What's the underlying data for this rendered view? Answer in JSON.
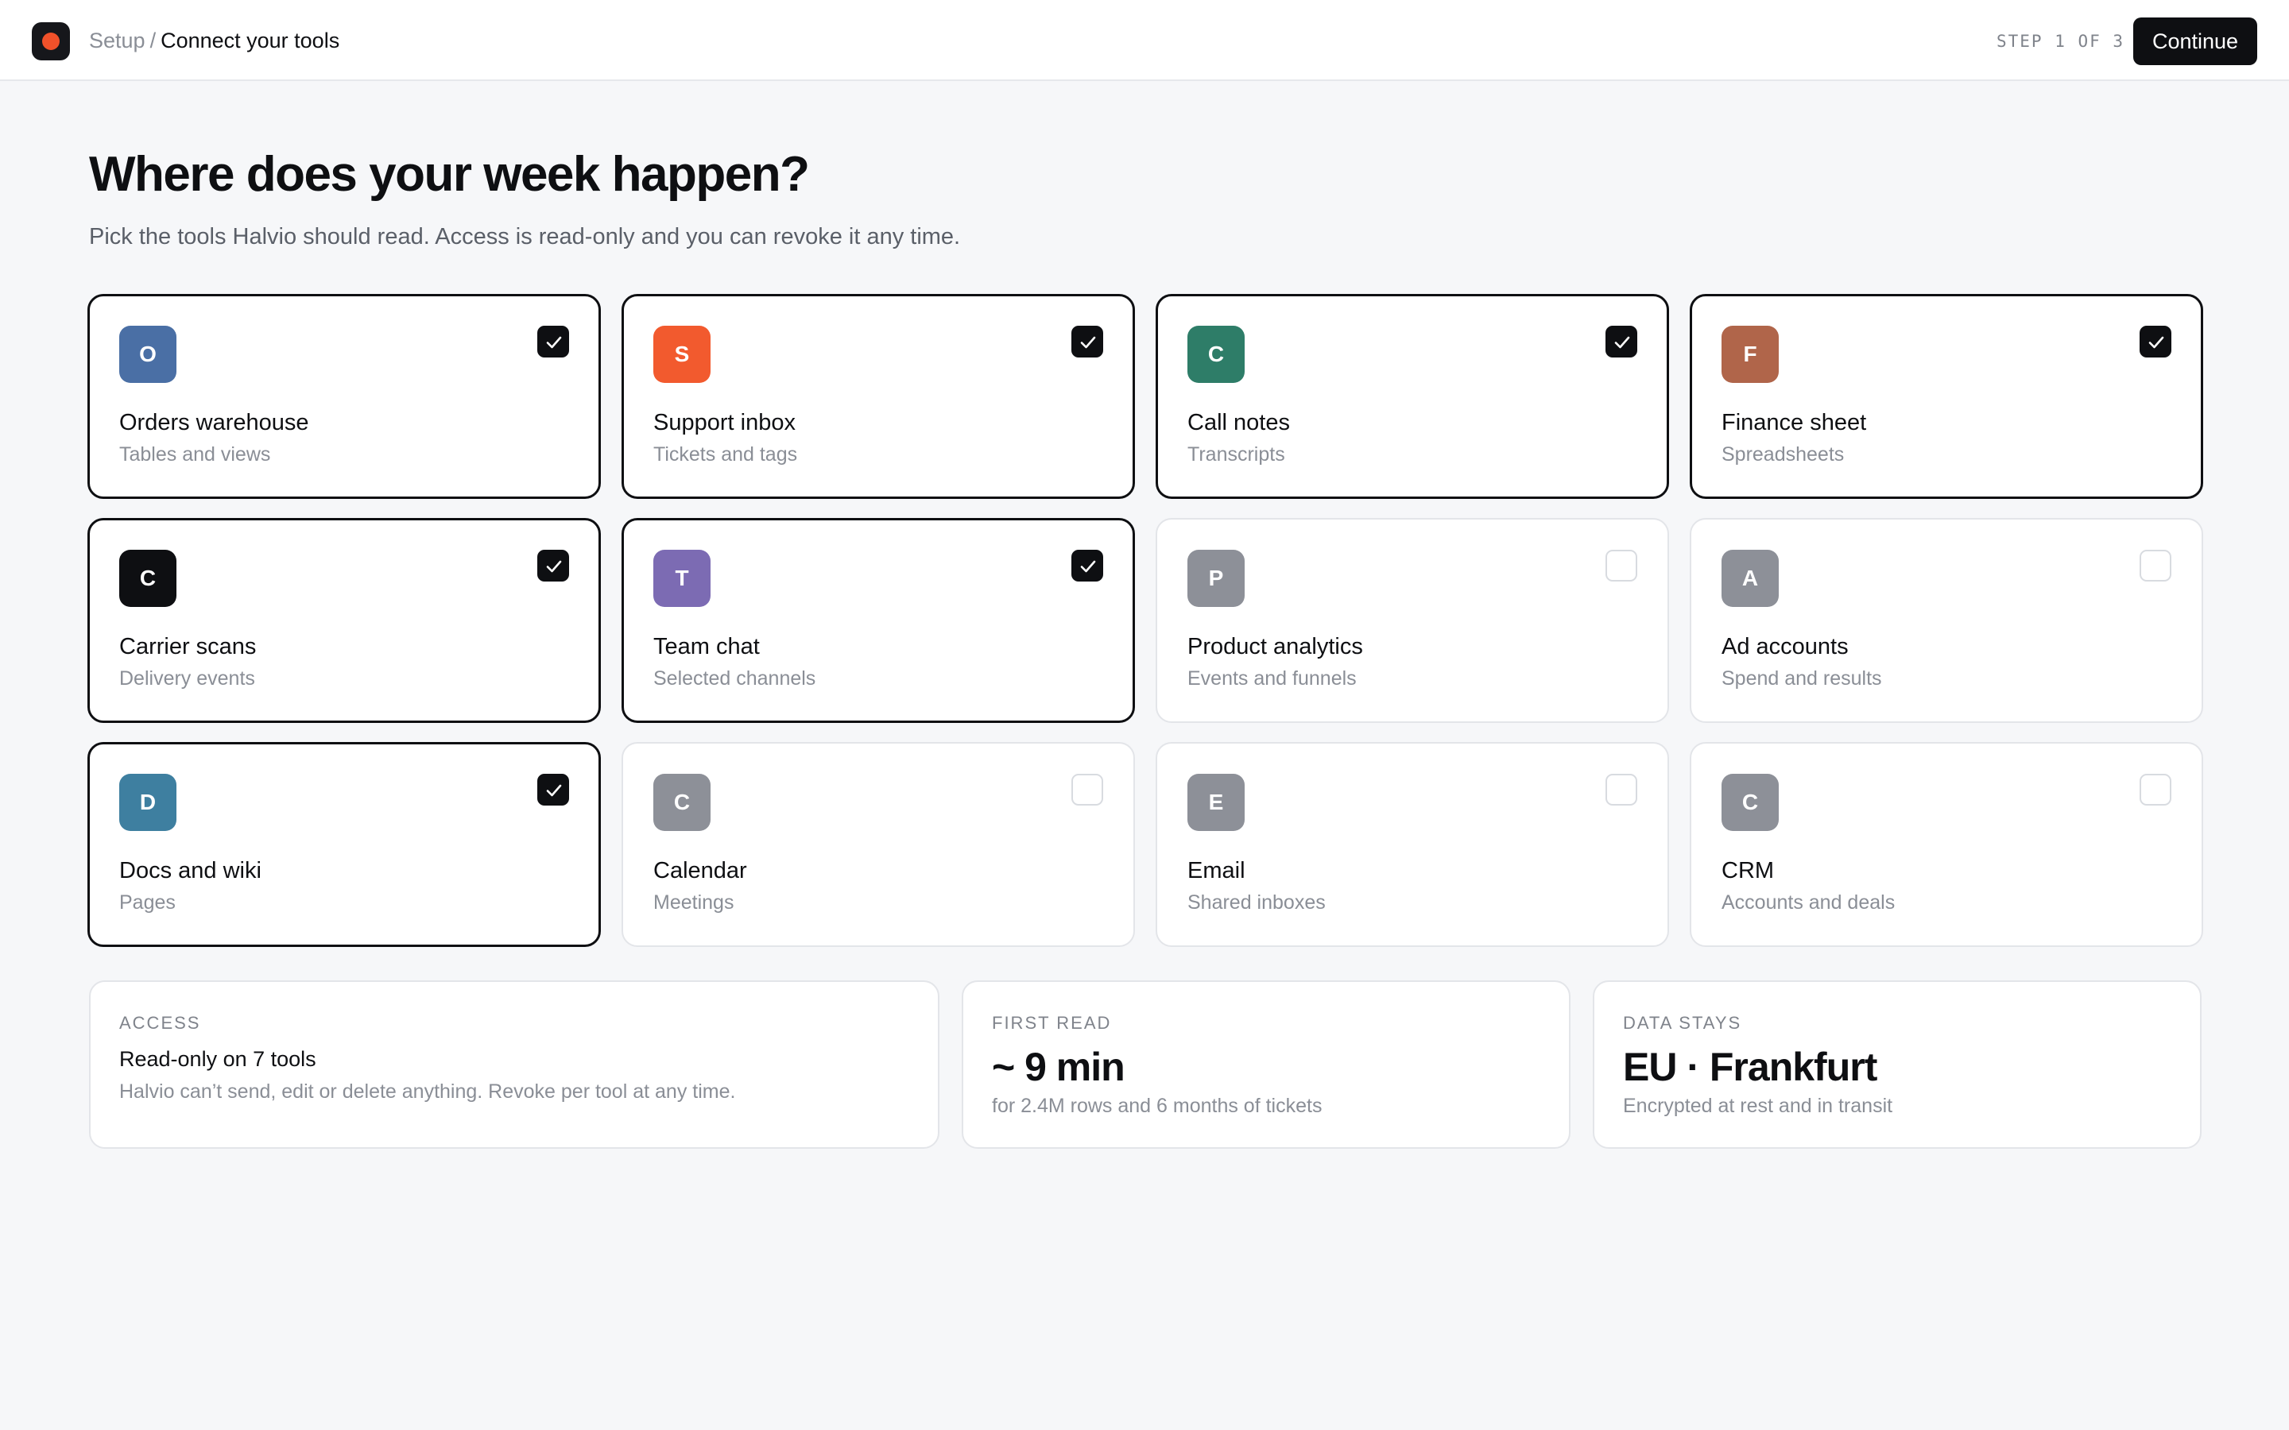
{
  "header": {
    "breadcrumb_parent": "Setup",
    "breadcrumb_separator": "/",
    "breadcrumb_current": "Connect your tools",
    "step_text": "STEP 1 OF 3",
    "continue_label": "Continue",
    "logo_colors": {
      "background": "#16171b",
      "dot": "#f0512a"
    }
  },
  "page": {
    "title": "Where does your week happen?",
    "subtitle": "Pick the tools Halvio should read. Access is read-only and you can revoke it any time."
  },
  "tools": [
    {
      "letter": "O",
      "name": "Orders warehouse",
      "desc": "Tables and views",
      "color": "#4a6fa5",
      "selected": true
    },
    {
      "letter": "S",
      "name": "Support inbox",
      "desc": "Tickets and tags",
      "color": "#f25a2e",
      "selected": true
    },
    {
      "letter": "C",
      "name": "Call notes",
      "desc": "Transcripts",
      "color": "#2e7d68",
      "selected": true
    },
    {
      "letter": "F",
      "name": "Finance sheet",
      "desc": "Spreadsheets",
      "color": "#b0654a",
      "selected": true
    },
    {
      "letter": "C",
      "name": "Carrier scans",
      "desc": "Delivery events",
      "color": "#0e0f12",
      "selected": true
    },
    {
      "letter": "T",
      "name": "Team chat",
      "desc": "Selected channels",
      "color": "#7c6bb3",
      "selected": true
    },
    {
      "letter": "P",
      "name": "Product analytics",
      "desc": "Events and funnels",
      "color": "#8d9098",
      "selected": false
    },
    {
      "letter": "A",
      "name": "Ad accounts",
      "desc": "Spend and results",
      "color": "#8d9098",
      "selected": false
    },
    {
      "letter": "D",
      "name": "Docs and wiki",
      "desc": "Pages",
      "color": "#3e7fa0",
      "selected": true
    },
    {
      "letter": "C",
      "name": "Calendar",
      "desc": "Meetings",
      "color": "#8d9098",
      "selected": false
    },
    {
      "letter": "E",
      "name": "Email",
      "desc": "Shared inboxes",
      "color": "#8d9098",
      "selected": false
    },
    {
      "letter": "C",
      "name": "CRM",
      "desc": "Accounts and deals",
      "color": "#8d9098",
      "selected": false
    }
  ],
  "info": {
    "access": {
      "label": "ACCESS",
      "title": "Read-only on 7 tools",
      "note": "Halvio can’t send, edit or delete anything. Revoke per tool at any time."
    },
    "first_read": {
      "label": "FIRST READ",
      "value": "~ 9 min",
      "note": "for 2.4M rows and 6 months of tickets"
    },
    "data_stays": {
      "label": "DATA STAYS",
      "value": "EU · Frankfurt",
      "note": "Encrypted at rest and in transit"
    }
  }
}
